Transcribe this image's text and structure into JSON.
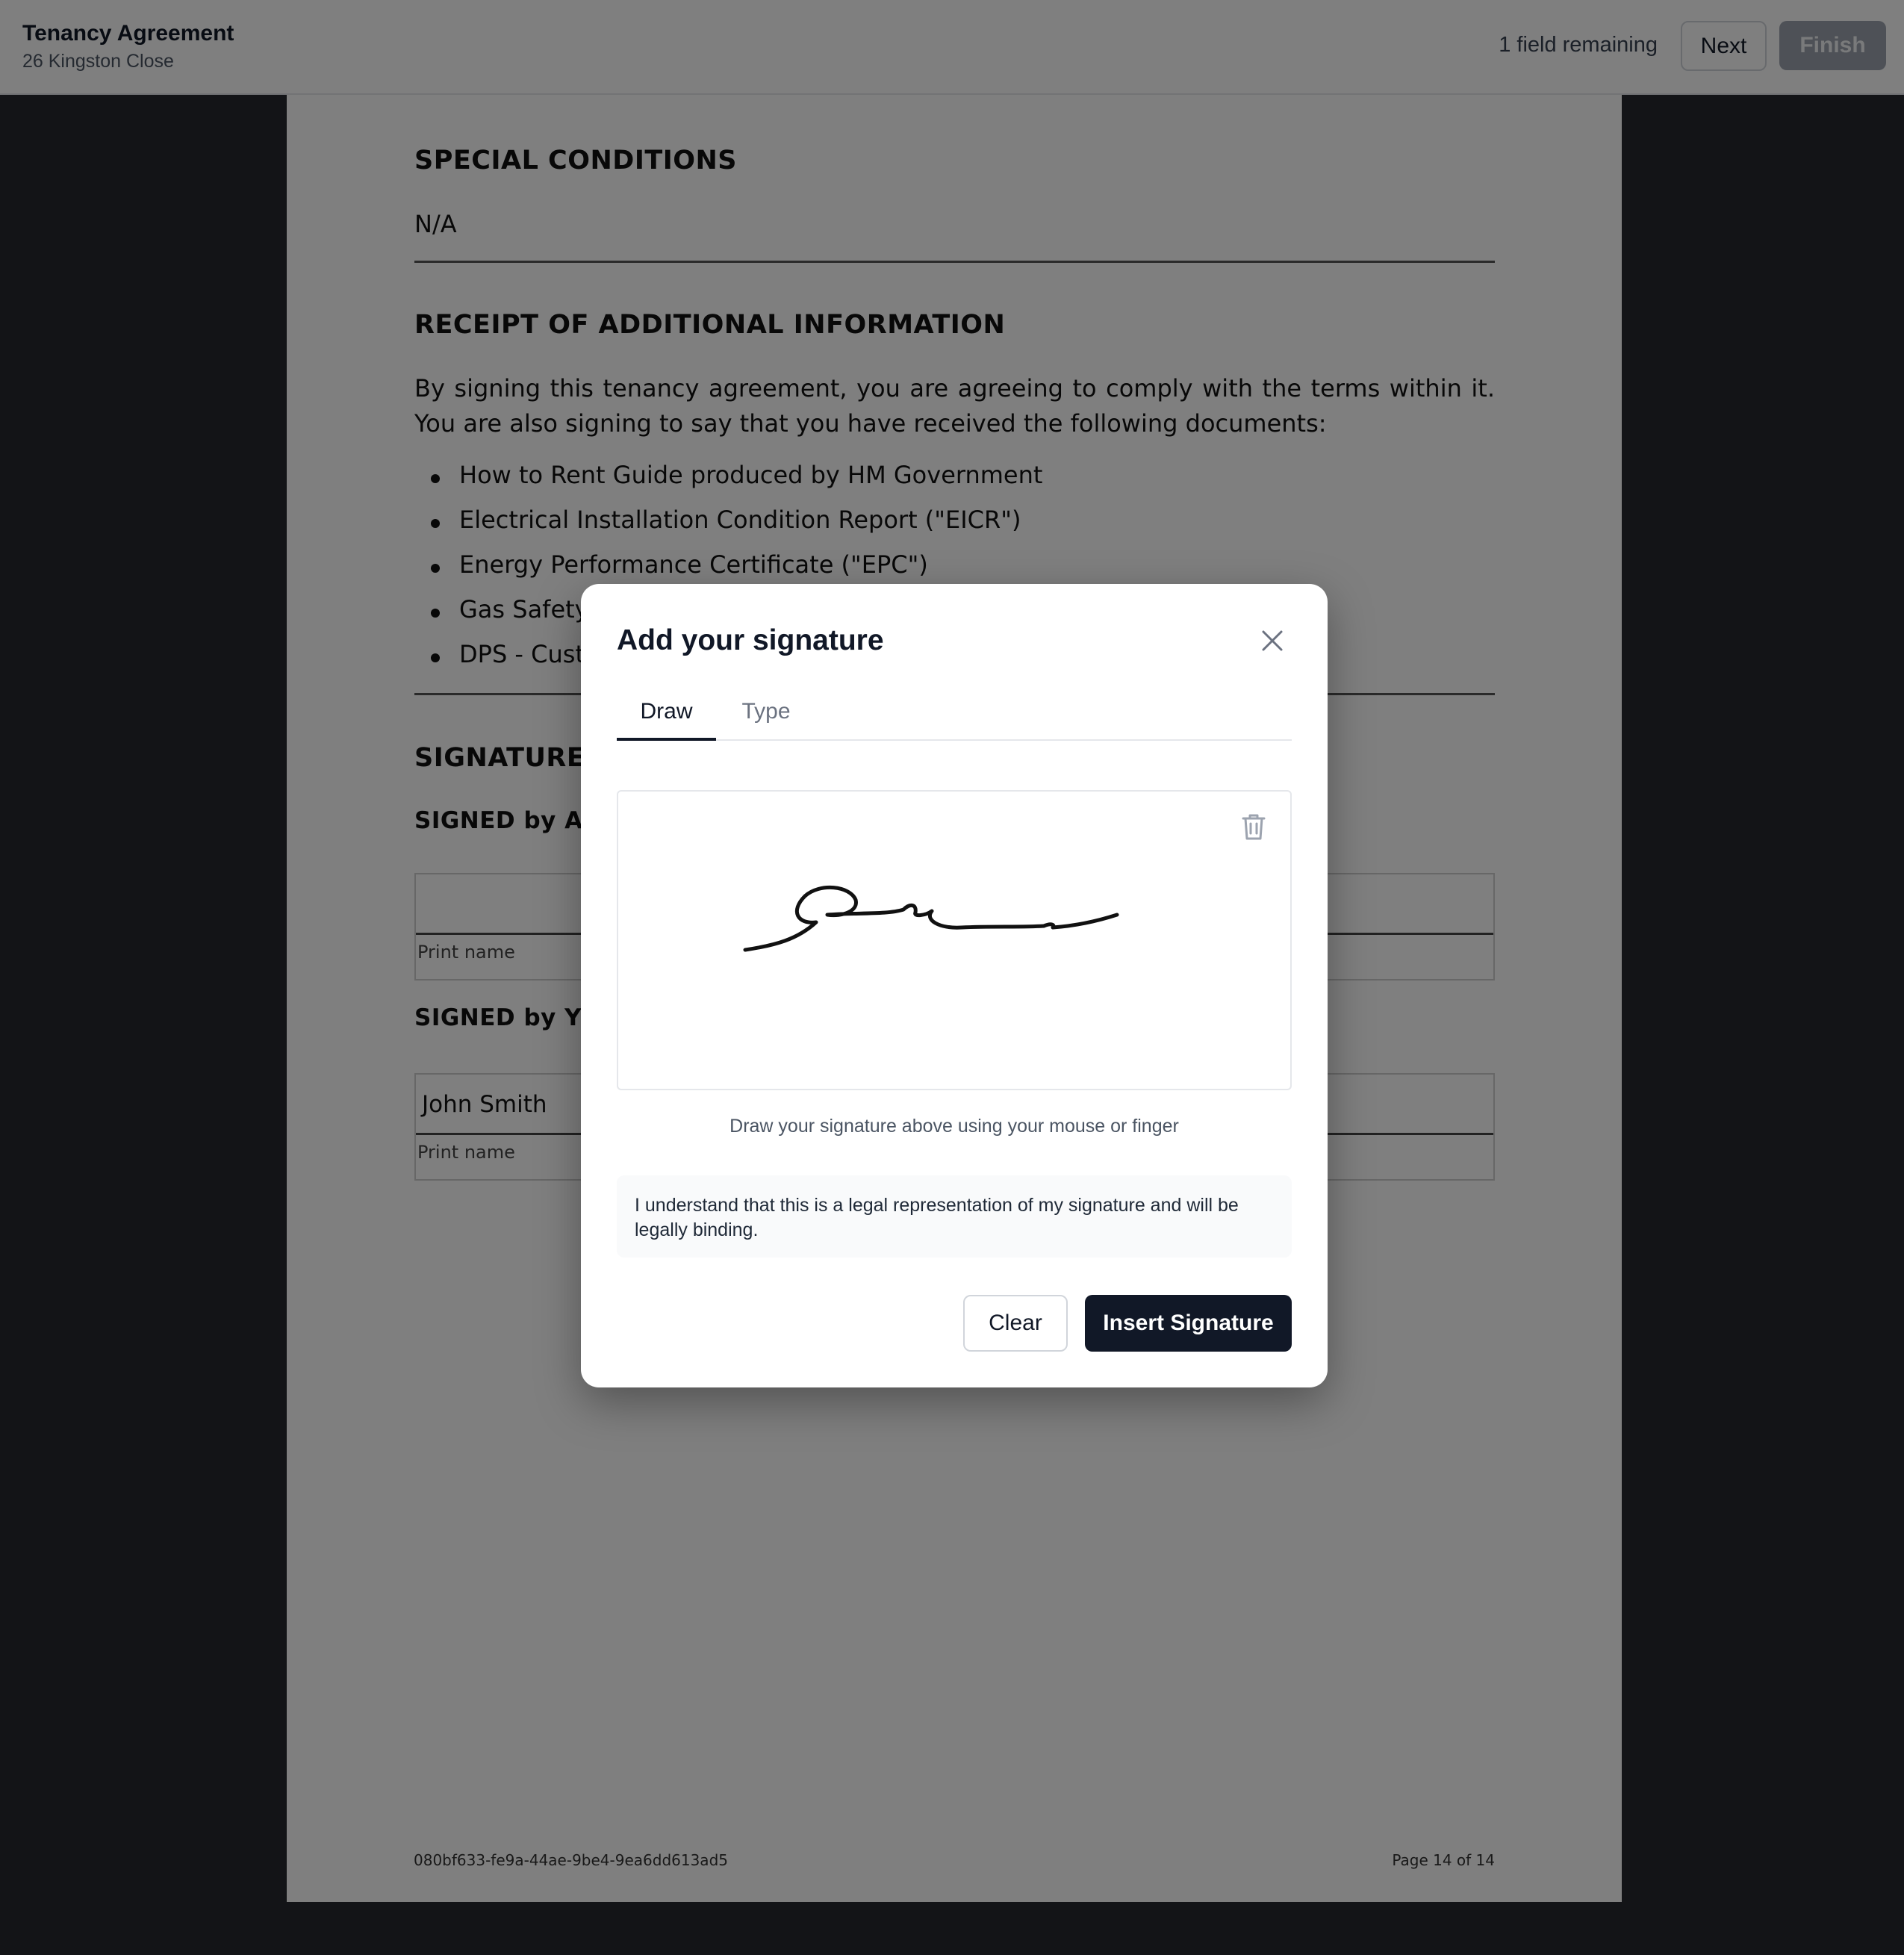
{
  "header": {
    "title": "Tenancy Agreement",
    "subtitle": "26 Kingston Close",
    "fields_remaining": "1 field remaining",
    "next_label": "Next",
    "finish_label": "Finish"
  },
  "document": {
    "special_conditions_heading": "SPECIAL CONDITIONS",
    "special_conditions_value": "N/A",
    "receipt_heading": "RECEIPT OF ADDITIONAL INFORMATION",
    "receipt_text": "By signing this tenancy agreement, you are agreeing to comply with the terms within it. You are also signing to say that you have received the following documents:",
    "documents": [
      "How to Rent Guide produced by HM Government",
      "Electrical Installation Condition Report (\"EICR\")",
      "Energy Performance Certificate (\"EPC\")",
      "Gas Safety C",
      "DPS - Custo"
    ],
    "signatures_heading": "SIGNATURES",
    "signed_by_agent": "SIGNED by AGE",
    "signed_by_you": "SIGNED by YOU",
    "agent_print_name_label": "Print name",
    "tenant_name": "John Smith",
    "tenant_print_name_label": "Print name",
    "document_id": "080bf633-fe9a-44ae-9be4-9ea6dd613ad5",
    "page_indicator": "Page 14 of 14"
  },
  "modal": {
    "title": "Add your signature",
    "tabs": [
      {
        "label": "Draw",
        "active": true
      },
      {
        "label": "Type",
        "active": false
      }
    ],
    "hint": "Draw your signature above using your mouse or finger",
    "legal_notice": "I understand that this is a legal representation of my signature and will be legally binding.",
    "clear_label": "Clear",
    "insert_label": "Insert Signature",
    "icons": [
      "close-icon",
      "trash-icon"
    ]
  },
  "colors": {
    "primary_button": "#111827",
    "overlay": "rgba(0,0,0,0.5)",
    "background": "#26292e"
  }
}
